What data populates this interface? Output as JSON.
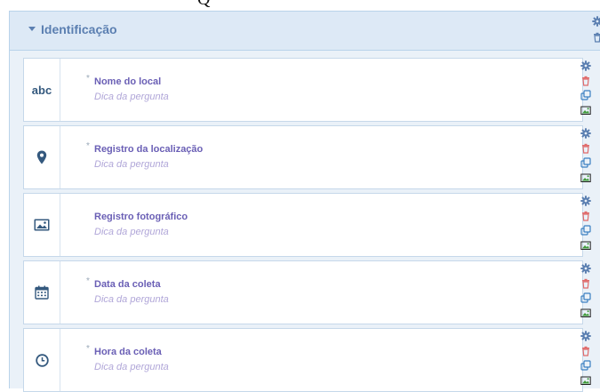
{
  "page_header_fragment": "Q",
  "section": {
    "title": "Identificação",
    "icons": [
      "caret-down-icon",
      "gear-icon",
      "trash-icon"
    ]
  },
  "questions": [
    {
      "icon": "text-abc-icon",
      "icon_text": "abc",
      "required": true,
      "required_mark": "*",
      "title": "Nome do local",
      "hint": "Dica da pergunta"
    },
    {
      "icon": "location-pin-icon",
      "required": true,
      "required_mark": "*",
      "title": "Registro da localização",
      "hint": "Dica da pergunta"
    },
    {
      "icon": "image-icon",
      "required": false,
      "title": "Registro fotográfico",
      "hint": "Dica da pergunta"
    },
    {
      "icon": "calendar-icon",
      "required": true,
      "required_mark": "*",
      "title": "Data da coleta",
      "hint": "Dica da pergunta"
    },
    {
      "icon": "clock-icon",
      "required": true,
      "required_mark": "*",
      "title": "Hora da coleta",
      "hint": "Dica da pergunta"
    }
  ],
  "question_tools": [
    "gear-icon",
    "trash-icon",
    "duplicate-icon",
    "add-image-icon"
  ],
  "colors": {
    "accent": "#5b7fb1",
    "icon_dark": "#34597e",
    "title": "#6a5fb5",
    "hint": "#b0a6d8",
    "delete": "#e06b6b",
    "image_tool": "#3f9a3a"
  }
}
